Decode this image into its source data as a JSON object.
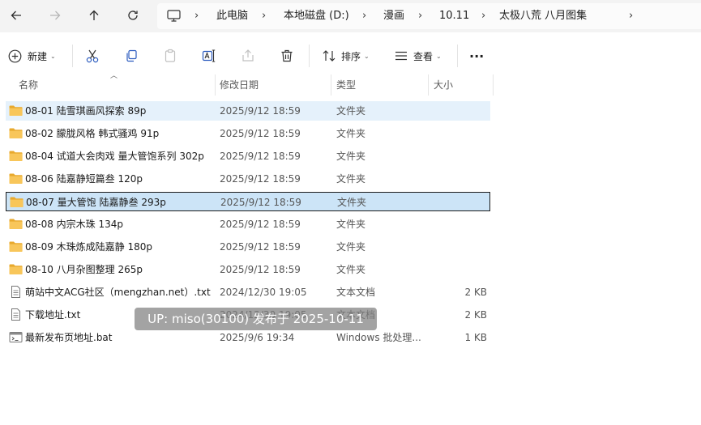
{
  "nav": {
    "back_icon": "arrow-left-icon",
    "forward_icon": "arrow-right-icon",
    "up_icon": "arrow-up-icon",
    "refresh_icon": "refresh-icon"
  },
  "breadcrumb": [
    "此电脑",
    "本地磁盘 (D:)",
    "漫画",
    "10.11",
    "太极八荒 八月图集"
  ],
  "toolbar": {
    "new_label": "新建",
    "sort_label": "排序",
    "view_label": "查看",
    "more_label": "···"
  },
  "columns": {
    "name": "名称",
    "date": "修改日期",
    "type": "类型",
    "size": "大小"
  },
  "files": [
    {
      "name": "08-01 陆雪琪画风探索 89p",
      "date": "2025/9/12 18:59",
      "type": "文件夹",
      "size": "",
      "icon": "folder-icon",
      "state": "hover"
    },
    {
      "name": "08-02 朦胧风格 韩式骚鸡 91p",
      "date": "2025/9/12 18:59",
      "type": "文件夹",
      "size": "",
      "icon": "folder-icon",
      "state": ""
    },
    {
      "name": "08-04 试道大会肉戏 量大管饱系列 302p",
      "date": "2025/9/12 18:59",
      "type": "文件夹",
      "size": "",
      "icon": "folder-icon",
      "state": ""
    },
    {
      "name": "08-06 陆嘉静短篇叁 120p",
      "date": "2025/9/12 18:59",
      "type": "文件夹",
      "size": "",
      "icon": "folder-icon",
      "state": ""
    },
    {
      "name": "08-07 量大管饱 陆嘉静叁  293p",
      "date": "2025/9/12 18:59",
      "type": "文件夹",
      "size": "",
      "icon": "folder-icon",
      "state": "selected"
    },
    {
      "name": "08-08 内宗木珠 134p",
      "date": "2025/9/12 18:59",
      "type": "文件夹",
      "size": "",
      "icon": "folder-icon",
      "state": ""
    },
    {
      "name": "08-09  木珠炼成陆嘉静  180p",
      "date": "2025/9/12 18:59",
      "type": "文件夹",
      "size": "",
      "icon": "folder-icon",
      "state": ""
    },
    {
      "name": "08-10  八月杂图整理  265p",
      "date": "2025/9/12 18:59",
      "type": "文件夹",
      "size": "",
      "icon": "folder-icon",
      "state": ""
    },
    {
      "name": "萌站中文ACG社区（mengzhan.net）.txt",
      "date": "2024/12/30 19:05",
      "type": "文本文档",
      "size": "2 KB",
      "icon": "text-file-icon",
      "state": ""
    },
    {
      "name": "下载地址.txt",
      "date": "2024/12/30 19:05",
      "type": "文本文档",
      "size": "2 KB",
      "icon": "text-file-icon",
      "state": ""
    },
    {
      "name": "最新发布页地址.bat",
      "date": "2025/9/6 19:34",
      "type": "Windows 批处理...",
      "size": "1 KB",
      "icon": "batch-file-icon",
      "state": ""
    }
  ],
  "watermark": "UP: miso(30100) 发布于 2025-10-11",
  "colors": {
    "folder": "#f8c65a",
    "selected_bg": "#cce4f7",
    "hover_bg": "#e5f1fb",
    "nav_bg": "#f3f3f3"
  }
}
